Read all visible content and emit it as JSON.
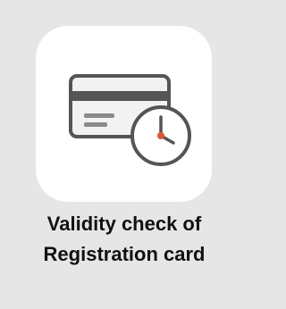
{
  "tile": {
    "icon": "registration-card-clock-icon",
    "label_line1": "Validity check of",
    "label_line2": "Registration card"
  },
  "colors": {
    "background": "#e6e6e6",
    "tile": "#ffffff",
    "icon_stroke": "#555555",
    "card_fill": "#f2f2f2",
    "clock_hand_accent": "#e8542a"
  }
}
